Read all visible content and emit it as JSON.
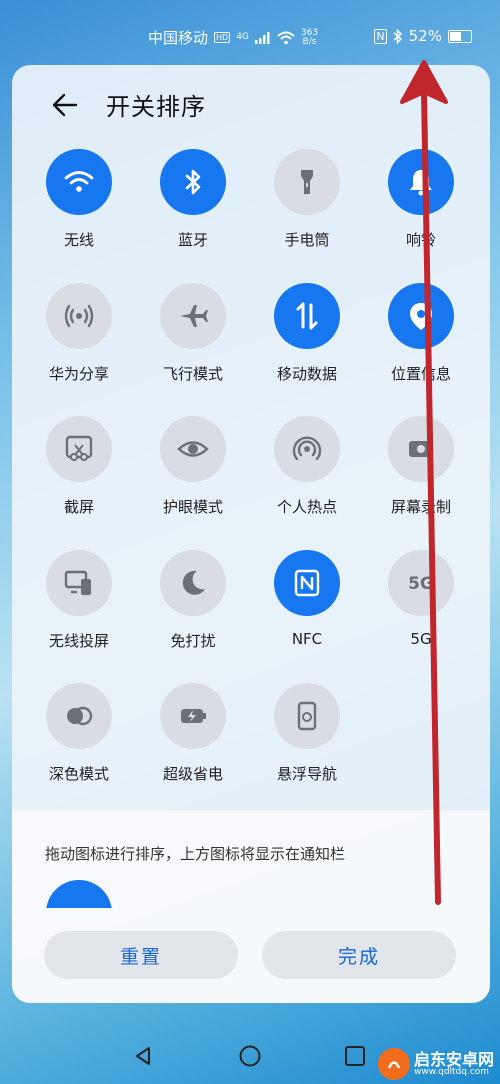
{
  "status_bar": {
    "carrier": "中国移动",
    "hd": "HD",
    "network": "4G",
    "speed_value": "363",
    "speed_unit": "B/s",
    "nfc": "N",
    "battery": "52%"
  },
  "header": {
    "title": "开关排序"
  },
  "tiles": [
    {
      "label": "无线",
      "icon": "wifi-icon",
      "on": true
    },
    {
      "label": "蓝牙",
      "icon": "bluetooth-icon",
      "on": true
    },
    {
      "label": "手电筒",
      "icon": "flashlight-icon",
      "on": false
    },
    {
      "label": "响铃",
      "icon": "bell-icon",
      "on": true
    },
    {
      "label": "华为分享",
      "icon": "huawei-share-icon",
      "on": false
    },
    {
      "label": "飞行模式",
      "icon": "airplane-icon",
      "on": false
    },
    {
      "label": "移动数据",
      "icon": "mobile-data-icon",
      "on": true
    },
    {
      "label": "位置信息",
      "icon": "location-icon",
      "on": true
    },
    {
      "label": "截屏",
      "icon": "screenshot-icon",
      "on": false
    },
    {
      "label": "护眼模式",
      "icon": "eye-icon",
      "on": false
    },
    {
      "label": "个人热点",
      "icon": "hotspot-icon",
      "on": false
    },
    {
      "label": "屏幕录制",
      "icon": "screen-record-icon",
      "on": false
    },
    {
      "label": "无线投屏",
      "icon": "wireless-projection-icon",
      "on": false
    },
    {
      "label": "免打扰",
      "icon": "moon-icon",
      "on": false
    },
    {
      "label": "NFC",
      "icon": "nfc-icon",
      "on": true
    },
    {
      "label": "5G",
      "icon": "5g-icon",
      "on": false
    },
    {
      "label": "深色模式",
      "icon": "dark-mode-icon",
      "on": false
    },
    {
      "label": "超级省电",
      "icon": "battery-saver-icon",
      "on": false
    },
    {
      "label": "悬浮导航",
      "icon": "floating-nav-icon",
      "on": false
    }
  ],
  "hint": "拖动图标进行排序，上方图标将显示在通知栏",
  "buttons": {
    "reset": "重置",
    "done": "完成"
  },
  "watermark": {
    "text": "启东安卓网",
    "url": "www.qdltdq.com"
  },
  "colors": {
    "accent": "#1677f0",
    "tile_off": "#d9dde3",
    "arrow": "#c0262c"
  }
}
